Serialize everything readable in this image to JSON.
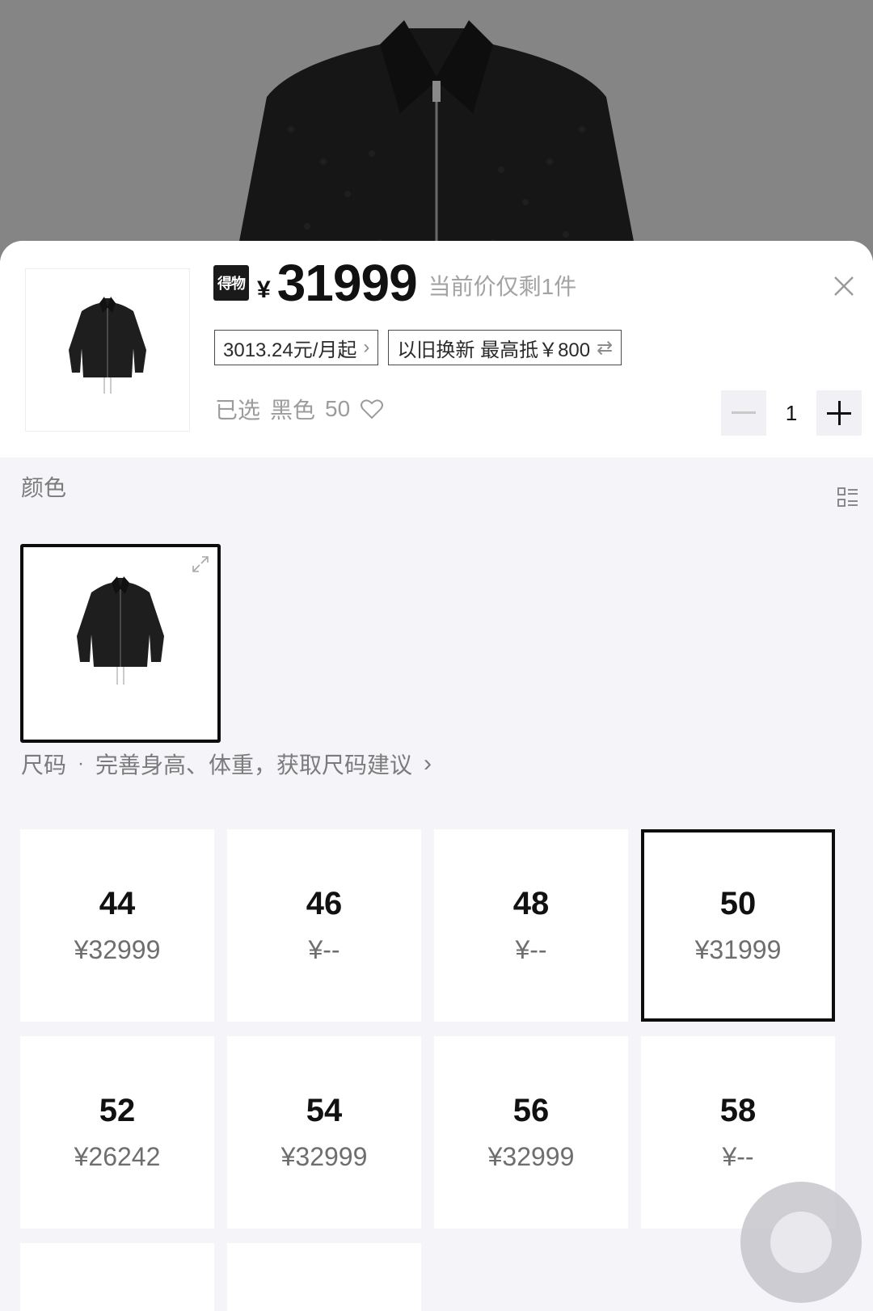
{
  "product": {
    "brand_badge": "得物",
    "currency": "¥",
    "price": "31999",
    "stock_note": "当前价仅剩1件",
    "installment_tag": "3013.24元/月起",
    "tradein_tag": "以旧换新 最高抵￥800",
    "selected_label": "已选",
    "selected_color": "黑色",
    "selected_size": "50",
    "quantity": "1"
  },
  "color_section": {
    "label": "颜色"
  },
  "size_section": {
    "label": "尺码",
    "hint": "完善身高、体重，获取尺码建议",
    "sizes": [
      {
        "size": "44",
        "price": "¥32999",
        "selected": false
      },
      {
        "size": "46",
        "price": "¥--",
        "selected": false
      },
      {
        "size": "48",
        "price": "¥--",
        "selected": false
      },
      {
        "size": "50",
        "price": "¥31999",
        "selected": true
      },
      {
        "size": "52",
        "price": "¥26242",
        "selected": false
      },
      {
        "size": "54",
        "price": "¥32999",
        "selected": false
      },
      {
        "size": "56",
        "price": "¥32999",
        "selected": false
      },
      {
        "size": "58",
        "price": "¥--",
        "selected": false
      }
    ]
  },
  "icons": {
    "close": "close-icon",
    "chevron": "chevron-right-icon",
    "swap": "swap-icon",
    "heart": "heart-outline-icon",
    "minus": "minus-icon",
    "plus": "plus-icon",
    "grid": "list-view-icon",
    "expand": "expand-icon"
  },
  "colors": {
    "accent": "#111111",
    "muted": "#9c9c9c",
    "sheet_bg": "#f5f5f9",
    "photo_bg": "#858585"
  }
}
